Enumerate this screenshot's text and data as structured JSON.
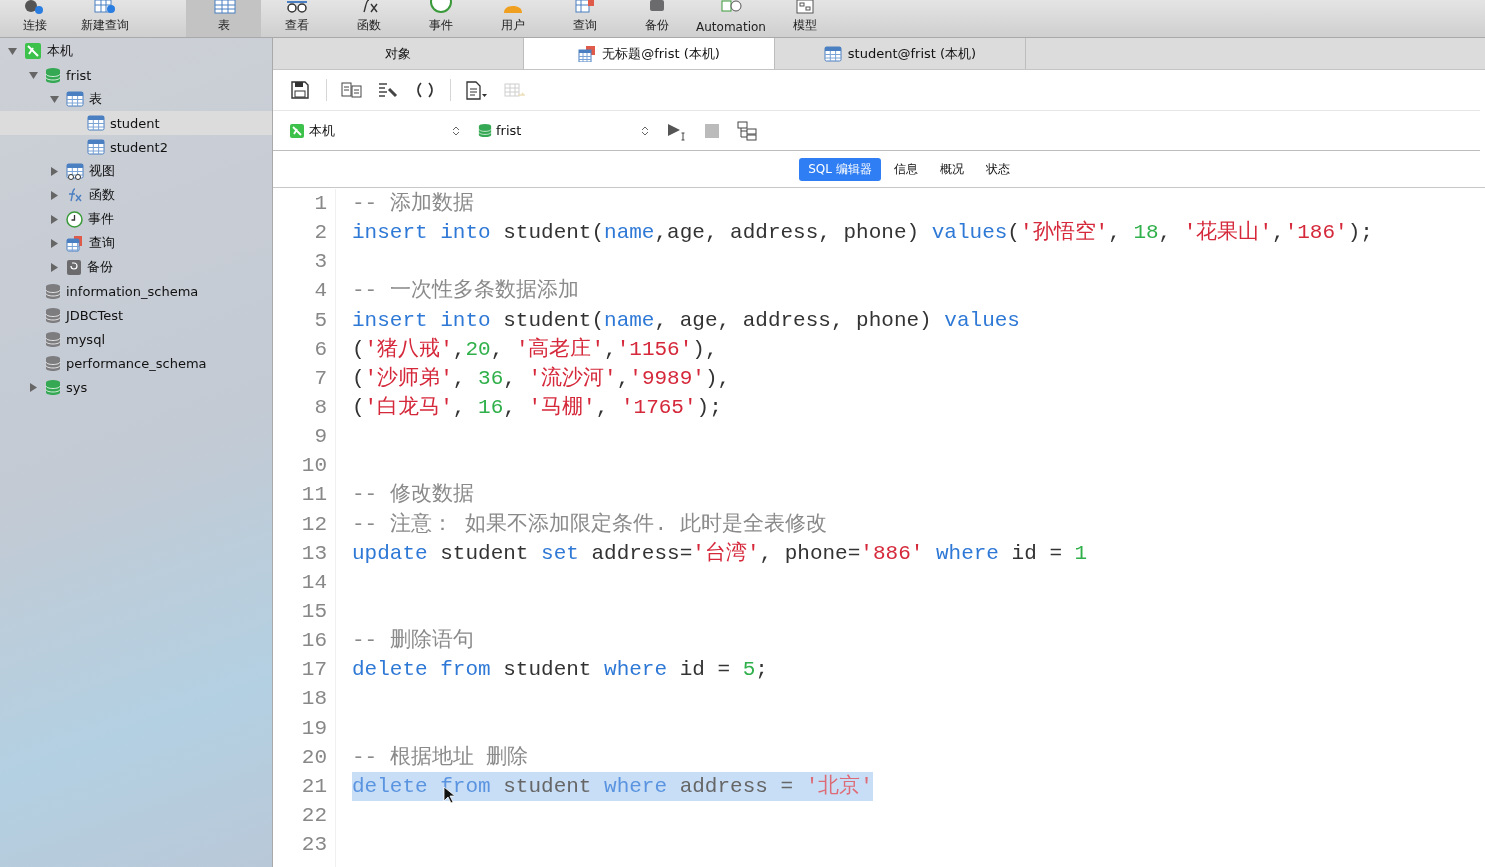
{
  "toolbar": [
    {
      "label": "连接",
      "kind": "connect",
      "selected": false
    },
    {
      "label": "新建查询",
      "kind": "new-query",
      "selected": false
    },
    {
      "label": "表",
      "kind": "table",
      "selected": true
    },
    {
      "label": "查看",
      "kind": "view",
      "selected": false
    },
    {
      "label": "函数",
      "kind": "function",
      "selected": false
    },
    {
      "label": "事件",
      "kind": "event",
      "selected": false
    },
    {
      "label": "用户",
      "kind": "user",
      "selected": false
    },
    {
      "label": "查询",
      "kind": "query",
      "selected": false
    },
    {
      "label": "备份",
      "kind": "backup",
      "selected": false
    },
    {
      "label": "Automation",
      "kind": "automation",
      "selected": false
    },
    {
      "label": "模型",
      "kind": "model",
      "selected": false
    }
  ],
  "sidebar": {
    "tree": [
      {
        "label": "本机",
        "kind": "connection",
        "expanded": true,
        "selected": false,
        "children": [
          {
            "label": "frist",
            "kind": "database-open",
            "expanded": true,
            "selected": false,
            "children": [
              {
                "label": "表",
                "kind": "tables",
                "expanded": true,
                "selected": false,
                "children": [
                  {
                    "label": "student",
                    "kind": "table",
                    "selected": true
                  },
                  {
                    "label": "student2",
                    "kind": "table",
                    "selected": false
                  }
                ]
              },
              {
                "label": "视图",
                "kind": "views",
                "expanded": false,
                "selected": false
              },
              {
                "label": "函数",
                "kind": "functions",
                "expanded": false,
                "selected": false
              },
              {
                "label": "事件",
                "kind": "events",
                "expanded": false,
                "selected": false
              },
              {
                "label": "查询",
                "kind": "queries",
                "expanded": false,
                "selected": false
              },
              {
                "label": "备份",
                "kind": "backups",
                "expanded": false,
                "selected": false
              }
            ]
          },
          {
            "label": "information_schema",
            "kind": "database",
            "selected": false
          },
          {
            "label": "JDBCTest",
            "kind": "database",
            "selected": false
          },
          {
            "label": "mysql",
            "kind": "database",
            "selected": false
          },
          {
            "label": "performance_schema",
            "kind": "database",
            "selected": false
          },
          {
            "label": "sys",
            "kind": "database-open",
            "expanded": false,
            "selected": false
          }
        ]
      }
    ]
  },
  "tabs": [
    {
      "label": "对象",
      "kind": "objects",
      "selected": false
    },
    {
      "label": "无标题@frist (本机)",
      "kind": "query",
      "selected": true
    },
    {
      "label": "student@frist (本机)",
      "kind": "table",
      "selected": false
    }
  ],
  "editor_toolbar": [
    {
      "kind": "save",
      "disabled": false
    },
    {
      "kind": "separator"
    },
    {
      "kind": "query-builder",
      "disabled": false
    },
    {
      "kind": "beautify",
      "disabled": false
    },
    {
      "kind": "parentheses",
      "disabled": false
    },
    {
      "kind": "separator"
    },
    {
      "kind": "snippet",
      "disabled": false
    },
    {
      "kind": "export",
      "disabled": true
    }
  ],
  "connection_select": {
    "value": "本机"
  },
  "database_select": {
    "value": "frist"
  },
  "editor_tabs": [
    {
      "label": "SQL 编辑器",
      "selected": true
    },
    {
      "label": "信息",
      "selected": false
    },
    {
      "label": "概况",
      "selected": false
    },
    {
      "label": "状态",
      "selected": false
    }
  ],
  "code": [
    {
      "number": "1",
      "selected": false,
      "tokens": [
        {
          "kind": "comment",
          "text": "-- 添加数据"
        }
      ]
    },
    {
      "number": "2",
      "selected": false,
      "tokens": [
        {
          "kind": "keyword",
          "text": "insert into"
        },
        {
          "kind": "plain",
          "text": " student("
        },
        {
          "kind": "keyword",
          "text": "name"
        },
        {
          "kind": "plain",
          "text": ",age, address, phone) "
        },
        {
          "kind": "keyword",
          "text": "values"
        },
        {
          "kind": "plain",
          "text": "("
        },
        {
          "kind": "string",
          "text": "'孙悟空'"
        },
        {
          "kind": "plain",
          "text": ", "
        },
        {
          "kind": "number",
          "text": "18"
        },
        {
          "kind": "plain",
          "text": ", "
        },
        {
          "kind": "string",
          "text": "'花果山'"
        },
        {
          "kind": "plain",
          "text": ","
        },
        {
          "kind": "string",
          "text": "'186'"
        },
        {
          "kind": "plain",
          "text": ");"
        }
      ]
    },
    {
      "number": "3",
      "selected": false
    },
    {
      "number": "4",
      "selected": false,
      "tokens": [
        {
          "kind": "comment",
          "text": "-- 一次性多条数据添加"
        }
      ]
    },
    {
      "number": "5",
      "selected": false,
      "tokens": [
        {
          "kind": "keyword",
          "text": "insert into"
        },
        {
          "kind": "plain",
          "text": " student("
        },
        {
          "kind": "keyword",
          "text": "name"
        },
        {
          "kind": "plain",
          "text": ", age, address, phone) "
        },
        {
          "kind": "keyword",
          "text": "values"
        }
      ]
    },
    {
      "number": "6",
      "selected": false,
      "tokens": [
        {
          "kind": "plain",
          "text": "("
        },
        {
          "kind": "string",
          "text": "'猪八戒'"
        },
        {
          "kind": "plain",
          "text": ","
        },
        {
          "kind": "number",
          "text": "20"
        },
        {
          "kind": "plain",
          "text": ", "
        },
        {
          "kind": "string",
          "text": "'高老庄'"
        },
        {
          "kind": "plain",
          "text": ","
        },
        {
          "kind": "string",
          "text": "'1156'"
        },
        {
          "kind": "plain",
          "text": "),"
        }
      ]
    },
    {
      "number": "7",
      "selected": false,
      "tokens": [
        {
          "kind": "plain",
          "text": "("
        },
        {
          "kind": "string",
          "text": "'沙师弟'"
        },
        {
          "kind": "plain",
          "text": ", "
        },
        {
          "kind": "number",
          "text": "36"
        },
        {
          "kind": "plain",
          "text": ", "
        },
        {
          "kind": "string",
          "text": "'流沙河'"
        },
        {
          "kind": "plain",
          "text": ","
        },
        {
          "kind": "string",
          "text": "'9989'"
        },
        {
          "kind": "plain",
          "text": "),"
        }
      ]
    },
    {
      "number": "8",
      "selected": false,
      "tokens": [
        {
          "kind": "plain",
          "text": "("
        },
        {
          "kind": "string",
          "text": "'白龙马'"
        },
        {
          "kind": "plain",
          "text": ", "
        },
        {
          "kind": "number",
          "text": "16"
        },
        {
          "kind": "plain",
          "text": ", "
        },
        {
          "kind": "string",
          "text": "'马棚'"
        },
        {
          "kind": "plain",
          "text": ", "
        },
        {
          "kind": "string",
          "text": "'1765'"
        },
        {
          "kind": "plain",
          "text": ");"
        }
      ]
    },
    {
      "number": "9",
      "selected": false
    },
    {
      "number": "10",
      "selected": false
    },
    {
      "number": "11",
      "selected": false,
      "tokens": [
        {
          "kind": "comment",
          "text": "-- 修改数据"
        }
      ]
    },
    {
      "number": "12",
      "selected": false,
      "tokens": [
        {
          "kind": "comment",
          "text": "-- 注意： 如果不添加限定条件. 此时是全表修改"
        }
      ]
    },
    {
      "number": "13",
      "selected": false,
      "tokens": [
        {
          "kind": "keyword",
          "text": "update"
        },
        {
          "kind": "plain",
          "text": " student "
        },
        {
          "kind": "keyword",
          "text": "set"
        },
        {
          "kind": "plain",
          "text": " address="
        },
        {
          "kind": "string",
          "text": "'台湾'"
        },
        {
          "kind": "plain",
          "text": ", phone="
        },
        {
          "kind": "string",
          "text": "'886'"
        },
        {
          "kind": "keyword",
          "text": " where"
        },
        {
          "kind": "plain",
          "text": " id = "
        },
        {
          "kind": "number",
          "text": "1"
        }
      ]
    },
    {
      "number": "14",
      "selected": false
    },
    {
      "number": "15",
      "selected": false
    },
    {
      "number": "16",
      "selected": false,
      "tokens": [
        {
          "kind": "comment",
          "text": "-- 删除语句"
        }
      ]
    },
    {
      "number": "17",
      "selected": false,
      "tokens": [
        {
          "kind": "keyword",
          "text": "delete from"
        },
        {
          "kind": "plain",
          "text": " student "
        },
        {
          "kind": "keyword",
          "text": "where"
        },
        {
          "kind": "plain",
          "text": " id = "
        },
        {
          "kind": "number",
          "text": "5"
        },
        {
          "kind": "plain",
          "text": ";"
        }
      ]
    },
    {
      "number": "18",
      "selected": false
    },
    {
      "number": "19",
      "selected": false
    },
    {
      "number": "20",
      "selected": false,
      "tokens": [
        {
          "kind": "comment",
          "text": "-- 根据地址 删除"
        }
      ]
    },
    {
      "number": "21",
      "selected": true,
      "tokens": [
        {
          "kind": "keyword",
          "text": "delete from"
        },
        {
          "kind": "plain",
          "text": " student "
        },
        {
          "kind": "keyword",
          "text": "where"
        },
        {
          "kind": "plain",
          "text": " address = "
        },
        {
          "kind": "string",
          "text": "'北京'"
        }
      ]
    },
    {
      "number": "22",
      "selected": false
    },
    {
      "number": "23",
      "selected": false
    }
  ]
}
